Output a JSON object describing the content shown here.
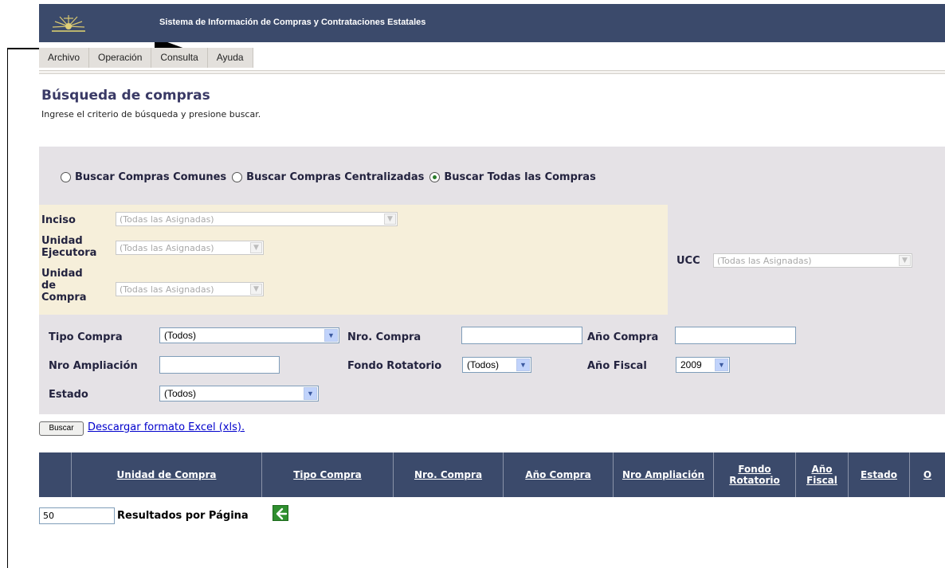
{
  "header": {
    "title": "Sistema de Información de Compras y Contrataciones Estatales"
  },
  "menu": [
    "Archivo",
    "Operación",
    "Consulta",
    "Ayuda"
  ],
  "page": {
    "title": "Búsqueda de compras",
    "subtitle": "Ingrese el criterio de búsqueda y presione buscar."
  },
  "search_type": {
    "options": [
      "Buscar Compras Comunes",
      "Buscar Compras Centralizadas",
      "Buscar Todas las Compras"
    ],
    "selected": "Buscar Todas las Compras"
  },
  "assignment": {
    "inciso_label": "Inciso",
    "inciso_value": "(Todas las Asignadas)",
    "unidad_ejecutora_label_1": "Unidad",
    "unidad_ejecutora_label_2": "Ejecutora",
    "unidad_ejecutora_value": "(Todas las Asignadas)",
    "unidad_compra_label_1": "Unidad",
    "unidad_compra_label_2": "de",
    "unidad_compra_label_3": "Compra",
    "unidad_compra_value": "(Todas las Asignadas)",
    "ucc_label": "UCC",
    "ucc_value": "(Todas las Asignadas)"
  },
  "filters": {
    "tipo_compra_label": "Tipo Compra",
    "tipo_compra_value": "(Todos)",
    "nro_compra_label": "Nro. Compra",
    "nro_compra_value": "",
    "anio_compra_label": "Año Compra",
    "anio_compra_value": "",
    "nro_ampliacion_label": "Nro Ampliación",
    "nro_ampliacion_value": "",
    "fondo_rotatorio_label": "Fondo Rotatorio",
    "fondo_rotatorio_value": "(Todos)",
    "anio_fiscal_label": "Año Fiscal",
    "anio_fiscal_value": "2009",
    "estado_label": "Estado",
    "estado_value": "(Todos)"
  },
  "actions": {
    "buscar_label": "Buscar",
    "excel_link": "Descargar formato Excel (xls)."
  },
  "table": {
    "columns": [
      "Unidad de Compra",
      "Tipo Compra",
      "Nro. Compra",
      "Año Compra",
      "Nro Ampliación",
      "Fondo Rotatorio",
      "Año Fiscal",
      "Estado",
      "O"
    ]
  },
  "pagination": {
    "per_page_value": "50",
    "per_page_label": "Resultados por Página"
  },
  "icons": {
    "back": "arrow-left-icon",
    "logo": "sun-logo-icon",
    "dropdown": "chevron-down-icon"
  },
  "colors": {
    "header_bg": "#3b4a6b",
    "panel_gray": "#e5e2e6",
    "panel_beige": "#f6efda",
    "link": "#0000cc"
  }
}
